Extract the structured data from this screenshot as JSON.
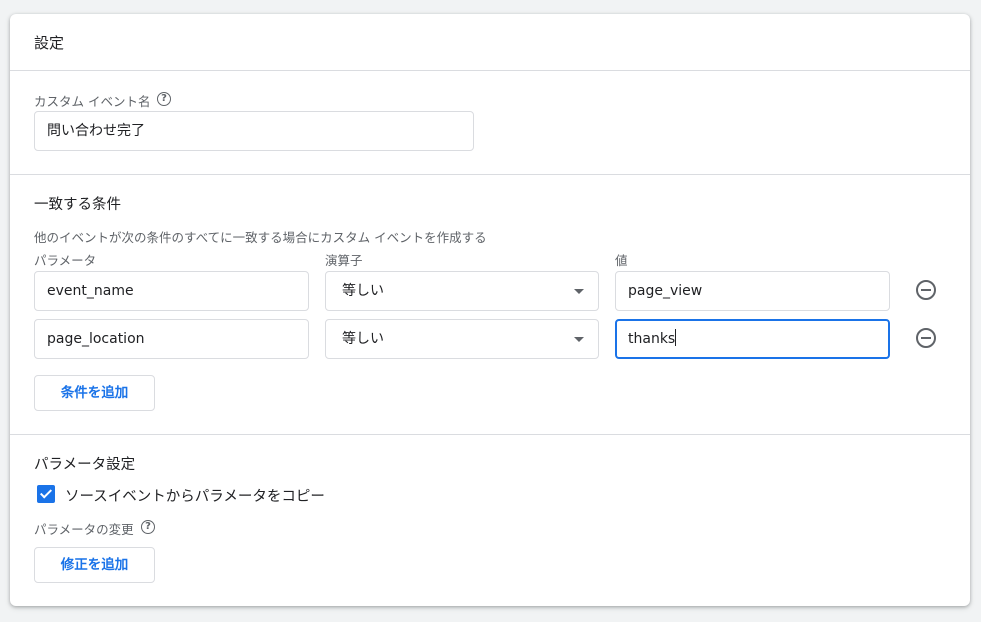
{
  "card": {
    "title": "設定"
  },
  "custom_event": {
    "label": "カスタム イベント名",
    "value": "問い合わせ完了"
  },
  "conditions": {
    "title": "一致する条件",
    "description": "他のイベントが次の条件のすべてに一致する場合にカスタム イベントを作成する",
    "col_parameter": "パラメータ",
    "col_operator": "演算子",
    "col_value": "値",
    "rows": [
      {
        "parameter": "event_name",
        "operator": "等しい",
        "value": "page_view"
      },
      {
        "parameter": "page_location",
        "operator": "等しい",
        "value": "thanks"
      }
    ],
    "add_button": "条件を追加"
  },
  "param_settings": {
    "title": "パラメータ設定",
    "copy_checkbox_label": "ソースイベントからパラメータをコピー",
    "copy_checked": true,
    "modify_label": "パラメータの変更",
    "add_modification_button": "修正を追加"
  },
  "icons": {
    "help": "help-icon",
    "remove": "remove-circle-icon",
    "dropdown": "dropdown-arrow-icon",
    "check": "check-icon"
  },
  "colors": {
    "accent": "#1a73e8",
    "border": "#dadce0",
    "muted_text": "#5f6368"
  }
}
